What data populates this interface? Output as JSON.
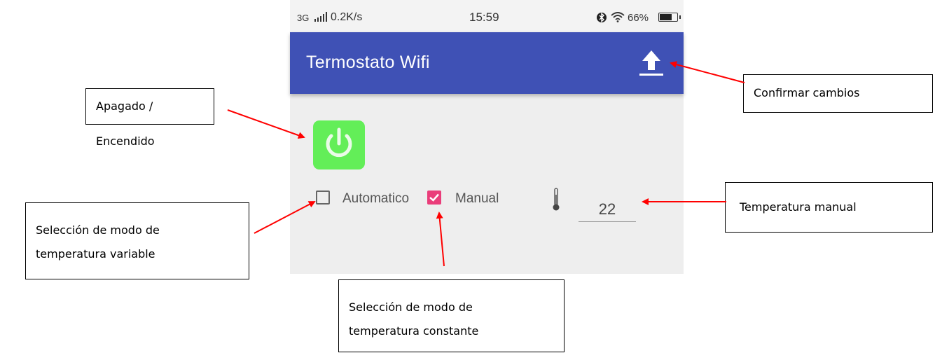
{
  "status_bar": {
    "network": "3G",
    "speed": "0.2K/s",
    "time": "15:59",
    "battery_percent": "66%",
    "icons": [
      "signal-icon",
      "bluetooth-icon",
      "wifi-icon",
      "battery-icon"
    ]
  },
  "app_bar": {
    "title": "Termostato Wifi",
    "action_icon": "upload-icon"
  },
  "controls": {
    "power_icon": "power-icon",
    "power_color": "#63ee58",
    "auto_label": "Automatico",
    "auto_checked": false,
    "manual_label": "Manual",
    "manual_checked": true,
    "manual_check_color": "#ea3d7a",
    "temperature_icon": "thermometer-icon",
    "temperature_value": "22"
  },
  "theme": {
    "primary": "#3f51b5",
    "background": "#eeeeee",
    "arrow": "#ff0000"
  },
  "annotations": {
    "power": "Apagado / Encendido",
    "confirm": "Confirmar cambios",
    "auto_mode": [
      "Selección de modo de",
      "temperatura variable"
    ],
    "manual_mode": [
      "Selección de modo de",
      "temperatura constante"
    ],
    "temperature": "Temperatura manual"
  }
}
